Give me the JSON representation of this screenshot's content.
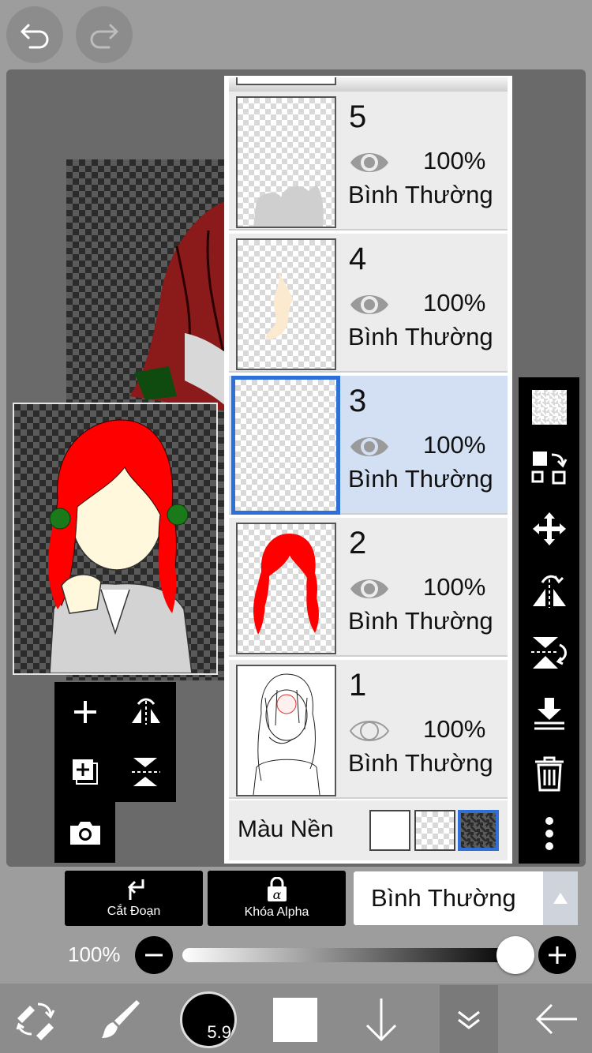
{
  "layers_panel": {
    "layers": [
      {
        "number": "5",
        "opacity": "100%",
        "blend_mode": "Bình Thường",
        "visible": true
      },
      {
        "number": "4",
        "opacity": "100%",
        "blend_mode": "Bình Thường",
        "visible": true
      },
      {
        "number": "3",
        "opacity": "100%",
        "blend_mode": "Bình Thường",
        "visible": true,
        "selected": true
      },
      {
        "number": "2",
        "opacity": "100%",
        "blend_mode": "Bình Thường",
        "visible": true
      },
      {
        "number": "1",
        "opacity": "100%",
        "blend_mode": "Bình Thường",
        "visible": false
      }
    ],
    "background_label": "Màu Nền",
    "background_selected": "dark-checker"
  },
  "actions": {
    "clipping_label": "Cắt Đoạn",
    "alpha_lock_label": "Khóa Alpha",
    "blend_mode_value": "Bình Thường"
  },
  "opacity": {
    "label": "100%",
    "value_fraction": 1.0
  },
  "bottom_toolbar": {
    "brush_size": "5.9"
  },
  "colors": {
    "accent": "#2f6fd8",
    "selected_layer_bg": "#d3e0f4",
    "hair_red": "#ff0000"
  },
  "icons": {
    "undo": "undo-icon",
    "redo": "redo-icon",
    "checker": "transparency-icon",
    "transform": "transform-icon",
    "move": "move-icon",
    "flip_h": "flip-horizontal-icon",
    "flip_v": "flip-vertical-icon",
    "merge_down": "merge-down-icon",
    "delete": "trash-icon",
    "more": "more-vert-icon"
  }
}
